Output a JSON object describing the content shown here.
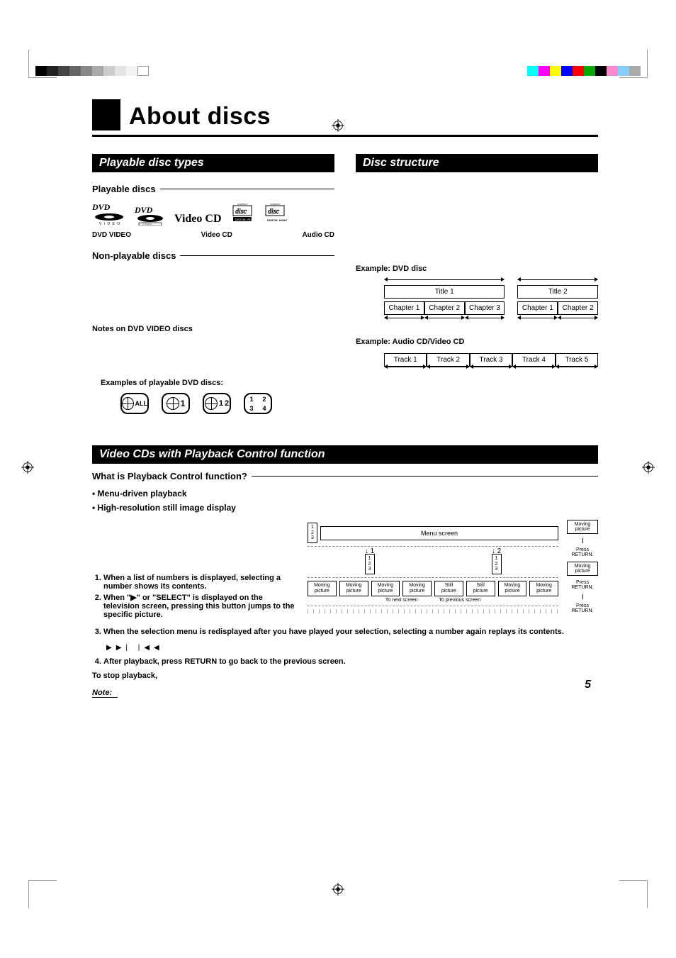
{
  "page": {
    "number": "5",
    "title": "About discs"
  },
  "section1": {
    "heading": "Playable disc types",
    "playable_label": "Playable discs",
    "nonplayable_label": "Non-playable discs",
    "notes_label": "Notes on DVD VIDEO discs",
    "examples_label": "Examples of playable DVD discs:",
    "logo_labels": {
      "dvd": "DVD VIDEO",
      "vcd": "Video CD",
      "acd": "Audio CD"
    },
    "videocd_logotype": "Video CD",
    "region_codes": {
      "all": "ALL",
      "r1": "1",
      "r12a": "1",
      "r12b": "2",
      "multi": [
        "1",
        "2",
        "3",
        "4"
      ]
    }
  },
  "section2": {
    "heading": "Disc structure",
    "ex1_label": "Example: DVD disc",
    "ex2_label": "Example: Audio CD/Video CD",
    "titles": [
      "Title 1",
      "Title 2"
    ],
    "chapters_t1": [
      "Chapter 1",
      "Chapter 2",
      "Chapter 3"
    ],
    "chapters_t2": [
      "Chapter 1",
      "Chapter 2"
    ],
    "tracks": [
      "Track 1",
      "Track 2",
      "Track 3",
      "Track 4",
      "Track 5"
    ]
  },
  "section3": {
    "heading": "Video CDs with Playback Control function",
    "q_label": "What is Playback Control function?",
    "bullets": [
      "Menu-driven playback",
      "High-resolution still image display"
    ],
    "steps": [
      "When a list of numbers is displayed, selecting a number shows its contents.",
      "When \"▶\" or \"SELECT\" is displayed on the television screen, pressing this button jumps to the specific picture.",
      "When the selection menu is redisplayed after you have played your selection, selecting a number again replays its contents.",
      "After playback, press RETURN to go back to the previous screen."
    ],
    "transport_hint": "▶▶|    |◀◀",
    "stop_label": "To stop playback,",
    "note_label": "Note:"
  },
  "flowchart": {
    "menu_screen": "Menu screen",
    "moving_picture": "Moving\npicture",
    "still_picture": "Still\npicture",
    "press_return": "Press\nRETURN.",
    "to_next": "To next screen",
    "to_prev": "To previous screen",
    "nums": [
      "1",
      "2",
      "3"
    ],
    "sub1": [
      "1",
      "2",
      "3"
    ],
    "sub2": [
      "1",
      "2",
      "3"
    ]
  }
}
